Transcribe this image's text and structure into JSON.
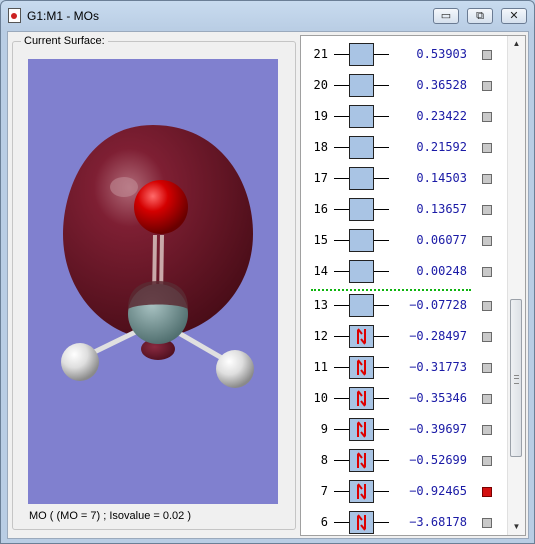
{
  "window": {
    "title": "G1:M1 - MOs",
    "controls": {
      "minimize": "▭",
      "restore": "⧉",
      "close": "✕"
    }
  },
  "surface": {
    "group_label": "Current Surface:",
    "status": "MO ( (MO = 7) ; Isovalue = 0.02 )",
    "colors": {
      "background": "#8080cf",
      "lobe": "#7a1a2e",
      "oxygen": "#cc0000",
      "hydrogen": "#e8e8e8",
      "central_atom": "#7a9a9a"
    }
  },
  "orbitals": [
    {
      "number": "21",
      "energy": "0.53903",
      "occupied": false,
      "selected": false
    },
    {
      "number": "20",
      "energy": "0.36528",
      "occupied": false,
      "selected": false
    },
    {
      "number": "19",
      "energy": "0.23422",
      "occupied": false,
      "selected": false
    },
    {
      "number": "18",
      "energy": "0.21592",
      "occupied": false,
      "selected": false
    },
    {
      "number": "17",
      "energy": "0.14503",
      "occupied": false,
      "selected": false
    },
    {
      "number": "16",
      "energy": "0.13657",
      "occupied": false,
      "selected": false
    },
    {
      "number": "15",
      "energy": "0.06077",
      "occupied": false,
      "selected": false
    },
    {
      "number": "14",
      "energy": "0.00248",
      "occupied": false,
      "selected": false
    },
    {
      "number": "13",
      "energy": "-0.07728",
      "occupied": false,
      "selected": false
    },
    {
      "number": "12",
      "energy": "-0.28497",
      "occupied": true,
      "selected": false
    },
    {
      "number": "11",
      "energy": "-0.31773",
      "occupied": true,
      "selected": false
    },
    {
      "number": "10",
      "energy": "-0.35346",
      "occupied": true,
      "selected": false
    },
    {
      "number": "9",
      "energy": "-0.39697",
      "occupied": true,
      "selected": false
    },
    {
      "number": "8",
      "energy": "-0.52699",
      "occupied": true,
      "selected": false
    },
    {
      "number": "7",
      "energy": "-0.92465",
      "occupied": true,
      "selected": true
    },
    {
      "number": "6",
      "energy": "-3.68178",
      "occupied": true,
      "selected": false
    }
  ],
  "icons": {
    "occupied": "spin-paired-electrons-icon",
    "scroll_up": "chevron-up-icon",
    "scroll_down": "chevron-down-icon"
  }
}
